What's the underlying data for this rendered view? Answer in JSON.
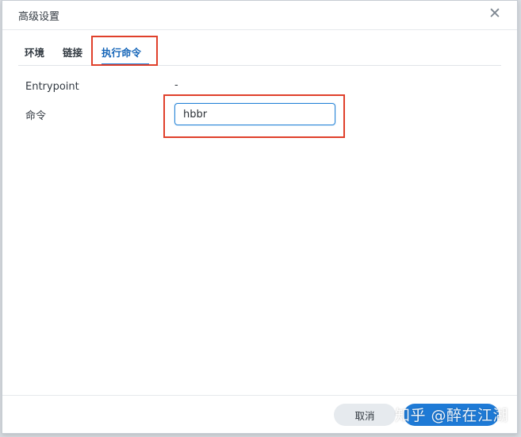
{
  "dialog": {
    "title": "高级设置",
    "close_icon": "close-icon",
    "close_glyph": "✕"
  },
  "tabs": [
    {
      "label": "环境",
      "active": false
    },
    {
      "label": "链接",
      "active": false
    },
    {
      "label": "执行命令",
      "active": true
    }
  ],
  "fields": {
    "entrypoint": {
      "label": "Entrypoint",
      "value": "-"
    },
    "command": {
      "label": "命令",
      "value": "hbbr"
    }
  },
  "footer": {
    "cancel_label": "取消",
    "ok_label": ""
  },
  "watermark": "知乎 @醉在江湖",
  "colors": {
    "accent": "#1e7ad6",
    "highlight": "#e0402b"
  }
}
